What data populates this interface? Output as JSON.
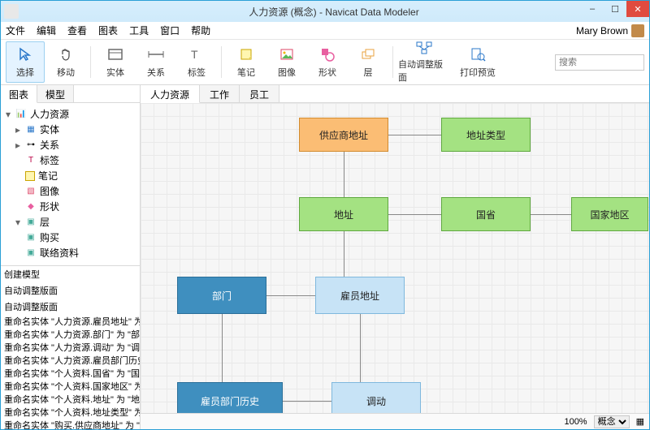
{
  "window": {
    "title": "人力资源 (概念) - Navicat Data Modeler"
  },
  "winbtns": {
    "min": "–",
    "max": "☐",
    "close": "✕"
  },
  "menu": [
    "文件",
    "编辑",
    "查看",
    "图表",
    "工具",
    "窗口",
    "帮助"
  ],
  "user": {
    "name": "Mary Brown"
  },
  "toolbar": {
    "select": "选择",
    "move": "移动",
    "entity": "实体",
    "relation": "关系",
    "label": "标签",
    "note": "笔记",
    "image": "图像",
    "shape": "形状",
    "layer": "层",
    "autolayout": "自动调整版面",
    "preview": "打印预览",
    "search_ph": "搜索"
  },
  "left_tabs": [
    "图表",
    "模型"
  ],
  "tree": {
    "root": "人力资源",
    "entity": "实体",
    "relation": "关系",
    "label": "标签",
    "note": "笔记",
    "image": "图像",
    "shape": "形状",
    "layer": "层",
    "layer_children": [
      "购买",
      "联络资料"
    ]
  },
  "log": {
    "l0": "创建模型",
    "l1": "自动调整版面",
    "l2": "自动调整版面",
    "lines": [
      "重命名实体 \"人力资源.雇员地址\" 为 \"雇员",
      "重命名实体 \"人力资源.部门\" 为 \"部门\"",
      "重命名实体 \"人力资源.调动\" 为 \"调动\"",
      "重命名实体 \"人力资源.雇员部门历史\" 为",
      "重命名实体 \"个人资料.国省\" 为 \"国省\"",
      "重命名实体 \"个人资料.国家地区\" 为 \"国家",
      "重命名实体 \"个人资料.地址\" 为 \"地址\"",
      "重命名实体 \"个人资料.地址类型\" 为 \"地址",
      "重命名实体 \"购买.供应商地址\" 为 \"供应商"
    ]
  },
  "canvas_tabs": [
    "人力资源",
    "工作",
    "员工"
  ],
  "entities": {
    "supplier_addr": "供应商地址",
    "addr_type": "地址类型",
    "addr": "地址",
    "province": "国省",
    "country": "国家地区",
    "dept": "部门",
    "emp_addr": "雇员地址",
    "emp_dept_hist": "雇员部门历史",
    "transfer": "调动"
  },
  "status": {
    "zoom": "100%",
    "mode": "概念"
  }
}
